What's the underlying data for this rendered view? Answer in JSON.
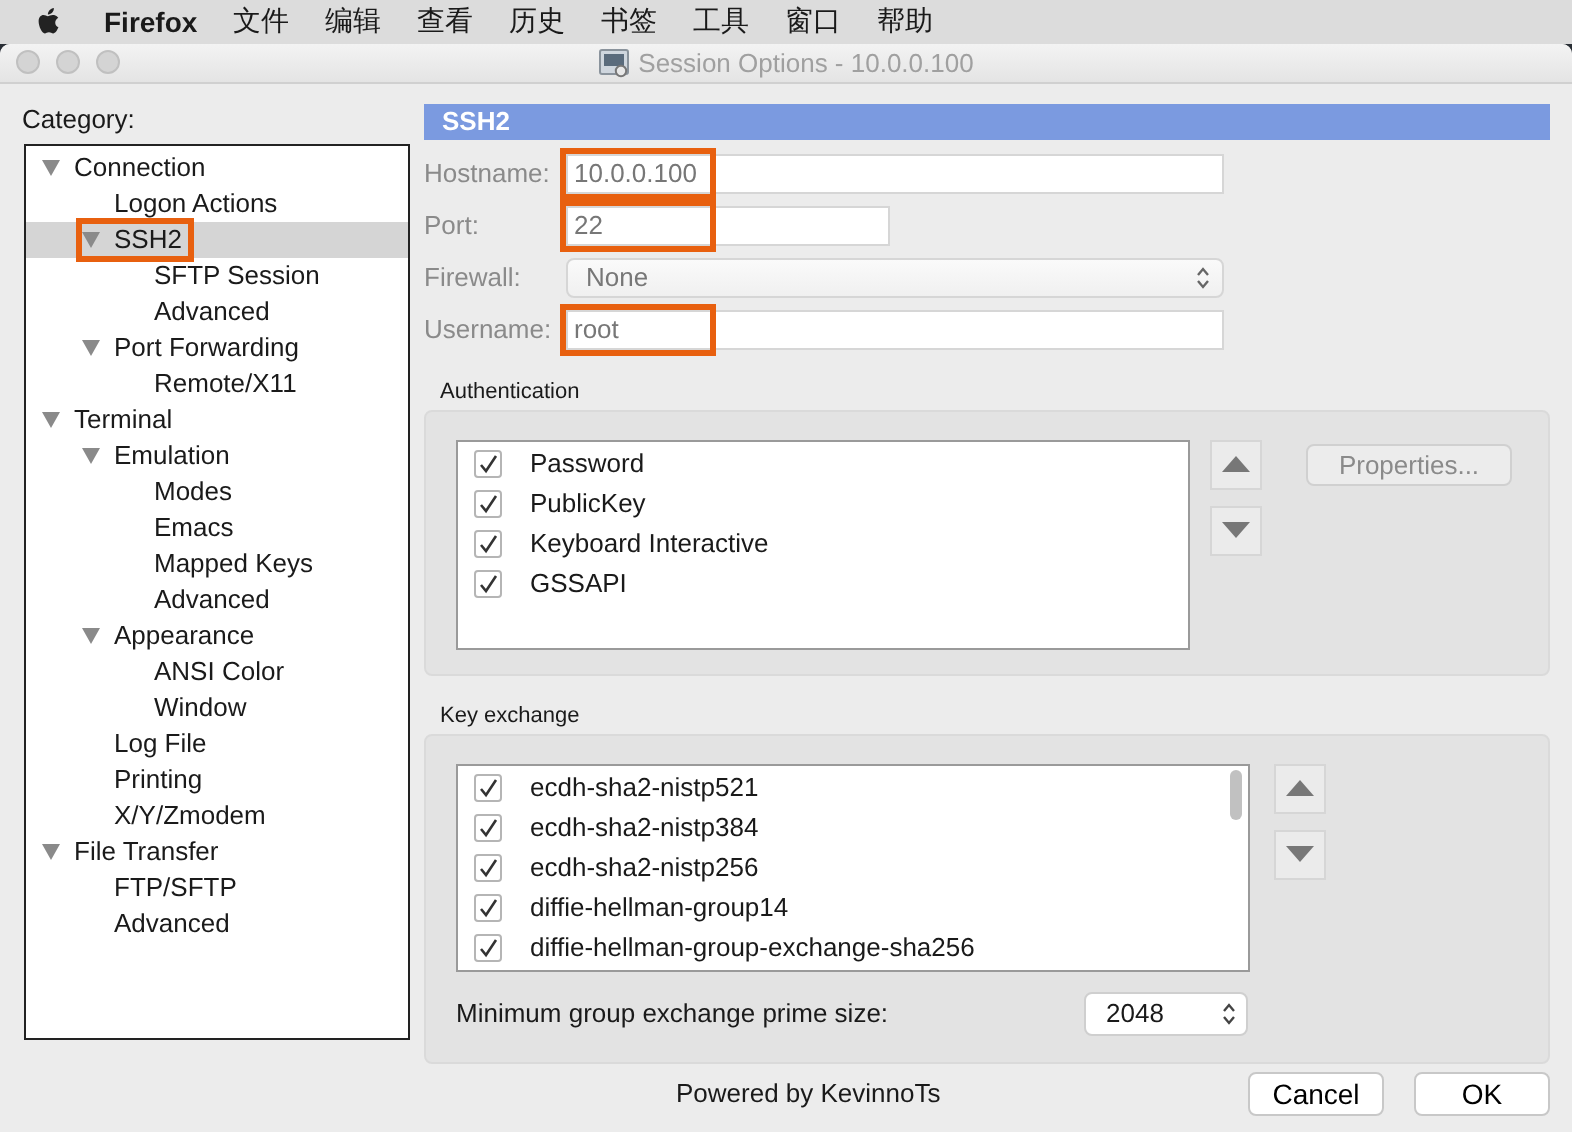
{
  "menubar": {
    "app": "Firefox",
    "items": [
      "文件",
      "编辑",
      "查看",
      "历史",
      "书签",
      "工具",
      "窗口",
      "帮助"
    ]
  },
  "window": {
    "title": "Session Options - 10.0.0.100"
  },
  "category": {
    "label": "Category:",
    "tree": [
      {
        "label": "Connection",
        "expanded": true,
        "selected": false,
        "highlighted": false,
        "children": [
          {
            "label": "Logon Actions",
            "selected": false,
            "highlighted": false
          },
          {
            "label": "SSH2",
            "expanded": true,
            "selected": true,
            "highlighted": true,
            "children": [
              {
                "label": "SFTP Session",
                "selected": false,
                "highlighted": false
              },
              {
                "label": "Advanced",
                "selected": false,
                "highlighted": false
              }
            ]
          },
          {
            "label": "Port Forwarding",
            "expanded": true,
            "selected": false,
            "highlighted": false,
            "children": [
              {
                "label": "Remote/X11",
                "selected": false,
                "highlighted": false
              }
            ]
          }
        ]
      },
      {
        "label": "Terminal",
        "expanded": true,
        "selected": false,
        "highlighted": false,
        "children": [
          {
            "label": "Emulation",
            "expanded": true,
            "selected": false,
            "highlighted": false,
            "children": [
              {
                "label": "Modes",
                "selected": false,
                "highlighted": false
              },
              {
                "label": "Emacs",
                "selected": false,
                "highlighted": false
              },
              {
                "label": "Mapped Keys",
                "selected": false,
                "highlighted": false
              },
              {
                "label": "Advanced",
                "selected": false,
                "highlighted": false
              }
            ]
          },
          {
            "label": "Appearance",
            "expanded": true,
            "selected": false,
            "highlighted": false,
            "children": [
              {
                "label": "ANSI Color",
                "selected": false,
                "highlighted": false
              },
              {
                "label": "Window",
                "selected": false,
                "highlighted": false
              }
            ]
          },
          {
            "label": "Log File",
            "selected": false,
            "highlighted": false
          },
          {
            "label": "Printing",
            "selected": false,
            "highlighted": false
          },
          {
            "label": "X/Y/Zmodem",
            "selected": false,
            "highlighted": false
          }
        ]
      },
      {
        "label": "File Transfer",
        "expanded": true,
        "selected": false,
        "highlighted": false,
        "children": [
          {
            "label": "FTP/SFTP",
            "selected": false,
            "highlighted": false
          },
          {
            "label": "Advanced",
            "selected": false,
            "highlighted": false
          }
        ]
      }
    ]
  },
  "section": {
    "title": "SSH2"
  },
  "fields": [
    {
      "kind": "text",
      "label": "Hostname:",
      "value": "10.0.0.100",
      "highlighted": true,
      "disabled": true
    },
    {
      "kind": "number",
      "label": "Port:",
      "value": "22",
      "highlighted": true,
      "disabled": true
    },
    {
      "kind": "select",
      "label": "Firewall:",
      "value": "None",
      "highlighted": false,
      "disabled": true
    },
    {
      "kind": "text",
      "label": "Username:",
      "value": "root",
      "highlighted": true,
      "disabled": true
    }
  ],
  "authentication": {
    "title": "Authentication",
    "items": [
      {
        "label": "Password",
        "checked": true
      },
      {
        "label": "PublicKey",
        "checked": true
      },
      {
        "label": "Keyboard Interactive",
        "checked": true
      },
      {
        "label": "GSSAPI",
        "checked": true
      }
    ],
    "properties_button": {
      "label": "Properties...",
      "disabled": true
    }
  },
  "key_exchange": {
    "title": "Key exchange",
    "items": [
      {
        "label": "ecdh-sha2-nistp521",
        "checked": true
      },
      {
        "label": "ecdh-sha2-nistp384",
        "checked": true
      },
      {
        "label": "ecdh-sha2-nistp256",
        "checked": true
      },
      {
        "label": "diffie-hellman-group14",
        "checked": true
      },
      {
        "label": "diffie-hellman-group-exchange-sha256",
        "checked": true
      }
    ],
    "prime_size": {
      "label": "Minimum group exchange prime size:",
      "value": "2048"
    }
  },
  "footer": {
    "text": "Powered by KevinnoTs",
    "buttons": [
      "Cancel",
      "OK"
    ]
  }
}
